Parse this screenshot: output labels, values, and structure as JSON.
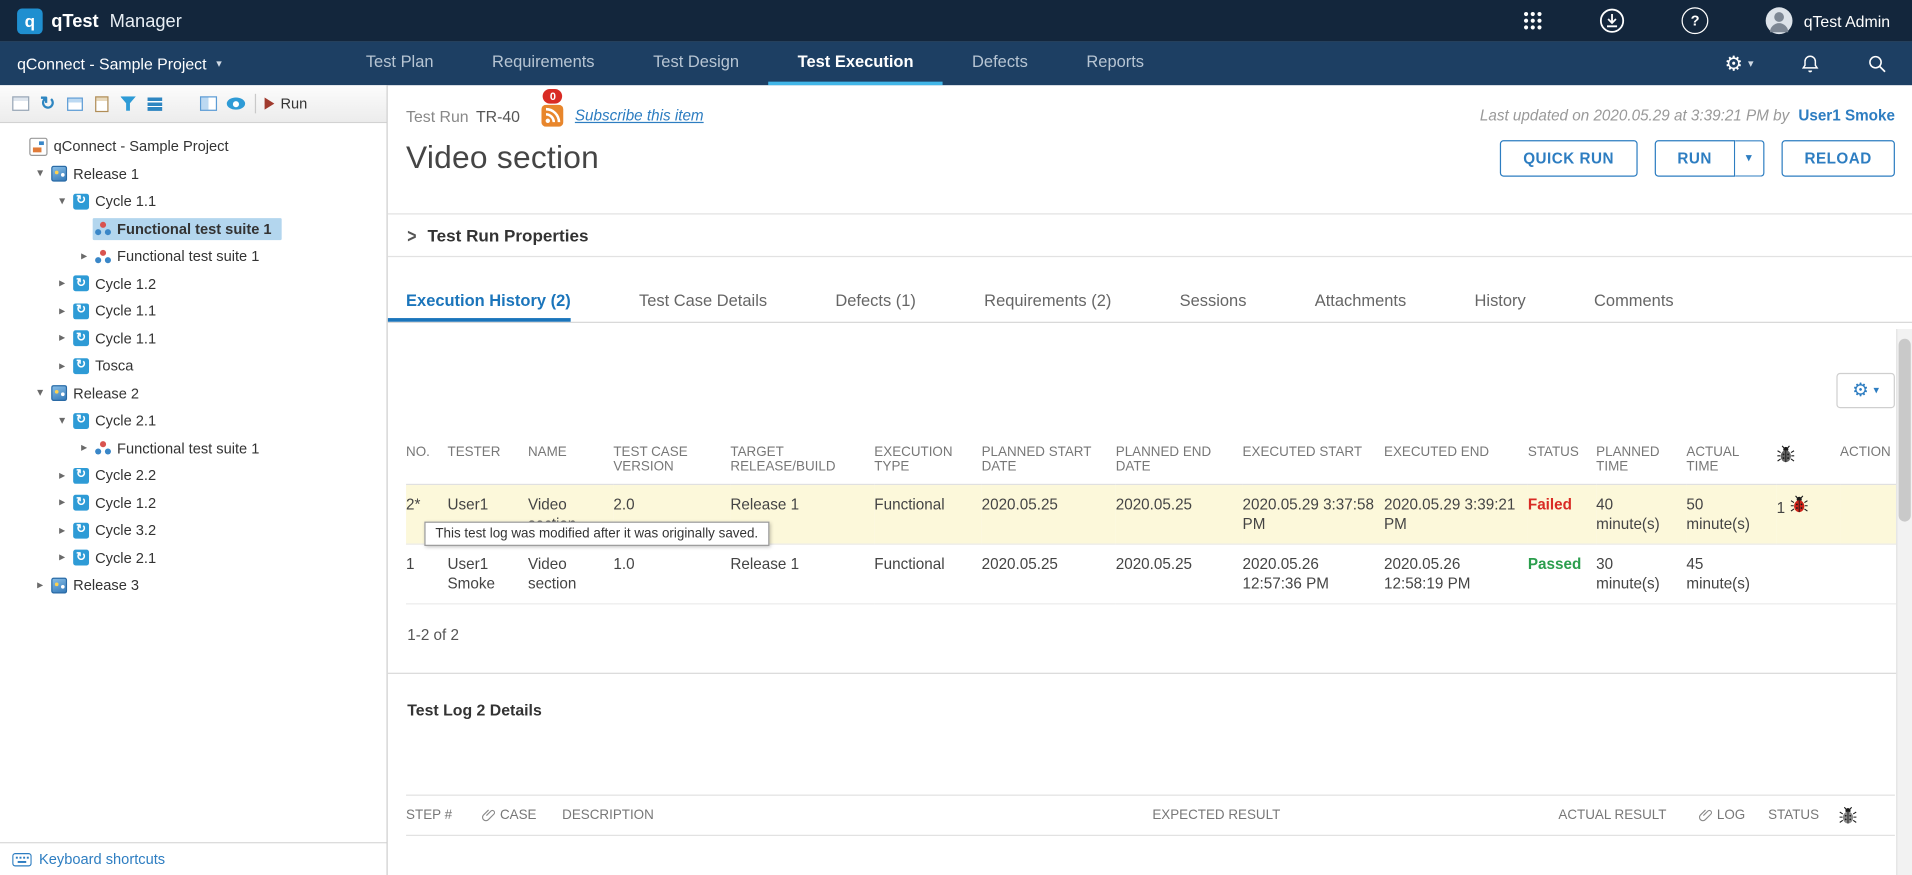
{
  "colors": {
    "topbar_bg": "#13263c",
    "navbar_bg": "#1d3f63",
    "accent_blue": "#2d7dc1",
    "nav_active_underline": "#41b6e8",
    "active_tab_blue": "#1b75bb",
    "failed_red": "#d92b24",
    "passed_green": "#2b9e4d",
    "modified_row_bg": "#fcf8da",
    "selected_tree_bg": "#b3d6ee"
  },
  "topbar": {
    "logo_mark": "q",
    "logo_text": "qTest",
    "product": "Manager",
    "user_name": "qTest Admin"
  },
  "nav": {
    "project_selector": "qConnect - Sample Project",
    "items": [
      {
        "label": "Test Plan",
        "active": false
      },
      {
        "label": "Requirements",
        "active": false
      },
      {
        "label": "Test Design",
        "active": false
      },
      {
        "label": "Test Execution",
        "active": true
      },
      {
        "label": "Defects",
        "active": false
      },
      {
        "label": "Reports",
        "active": false
      }
    ]
  },
  "sidebar": {
    "toolbar": {
      "icons": [
        "panels",
        "refresh",
        "new-window",
        "paste",
        "filter",
        "list",
        "excel-export",
        "split",
        "eye"
      ],
      "run_label": "Run"
    },
    "tree": [
      {
        "label": "qConnect - Sample Project",
        "level": 0,
        "type": "project",
        "state": "none",
        "selected": false
      },
      {
        "label": "Release 1",
        "level": 1,
        "type": "release",
        "state": "expanded",
        "selected": false
      },
      {
        "label": "Cycle 1.1",
        "level": 2,
        "type": "cycle",
        "state": "expanded",
        "selected": false
      },
      {
        "label": "Functional test suite 1",
        "level": 3,
        "type": "suite",
        "state": "none",
        "selected": true
      },
      {
        "label": "Functional test suite 1",
        "level": 3,
        "type": "suite",
        "state": "collapsed",
        "selected": false
      },
      {
        "label": "Cycle 1.2",
        "level": 2,
        "type": "cycle",
        "state": "collapsed",
        "selected": false
      },
      {
        "label": "Cycle 1.1",
        "level": 2,
        "type": "cycle",
        "state": "collapsed",
        "selected": false
      },
      {
        "label": "Cycle 1.1",
        "level": 2,
        "type": "cycle",
        "state": "collapsed",
        "selected": false
      },
      {
        "label": "Tosca",
        "level": 2,
        "type": "cycle",
        "state": "collapsed",
        "selected": false
      },
      {
        "label": "Release 2",
        "level": 1,
        "type": "release",
        "state": "expanded",
        "selected": false
      },
      {
        "label": "Cycle 2.1",
        "level": 2,
        "type": "cycle",
        "state": "expanded",
        "selected": false
      },
      {
        "label": "Functional test suite 1",
        "level": 3,
        "type": "suite",
        "state": "collapsed",
        "selected": false
      },
      {
        "label": "Cycle 2.2",
        "level": 2,
        "type": "cycle",
        "state": "collapsed",
        "selected": false
      },
      {
        "label": "Cycle 1.2",
        "level": 2,
        "type": "cycle",
        "state": "collapsed",
        "selected": false
      },
      {
        "label": "Cycle 3.2",
        "level": 2,
        "type": "cycle",
        "state": "collapsed",
        "selected": false
      },
      {
        "label": "Cycle 2.1",
        "level": 2,
        "type": "cycle",
        "state": "collapsed",
        "selected": false
      },
      {
        "label": "Release 3",
        "level": 1,
        "type": "release",
        "state": "collapsed",
        "selected": false
      }
    ],
    "footer_link": "Keyboard shortcuts"
  },
  "main": {
    "item_type": "Test Run",
    "item_id": "TR-40",
    "subscribe_badge": "0",
    "subscribe_label": "Subscribe this item",
    "last_updated_prefix": "Last updated on 2020.05.29 at 3:39:21 PM by",
    "last_updated_user": "User1 Smoke",
    "title": "Video section",
    "actions": {
      "quick_run": "QUICK RUN",
      "run": "RUN",
      "reload": "RELOAD"
    },
    "properties_header": "Test Run Properties",
    "tabs": [
      {
        "label": "Execution History (2)",
        "active": true
      },
      {
        "label": "Test Case Details",
        "active": false
      },
      {
        "label": "Defects (1)",
        "active": false
      },
      {
        "label": "Requirements (2)",
        "active": false
      },
      {
        "label": "Sessions",
        "active": false
      },
      {
        "label": "Attachments",
        "active": false
      },
      {
        "label": "History",
        "active": false
      },
      {
        "label": "Comments",
        "active": false
      }
    ],
    "history_table": {
      "headers": [
        {
          "label": "NO."
        },
        {
          "label": "TESTER"
        },
        {
          "label": "NAME"
        },
        {
          "label": "TEST CASE VERSION"
        },
        {
          "label": "TARGET RELEASE/BUILD"
        },
        {
          "label": "EXECUTION TYPE"
        },
        {
          "label": "PLANNED START DATE"
        },
        {
          "label": "PLANNED END DATE"
        },
        {
          "label": "EXECUTED START"
        },
        {
          "label": "EXECUTED END"
        },
        {
          "label": "STATUS"
        },
        {
          "label": "PLANNED TIME"
        },
        {
          "label": "ACTUAL TIME"
        },
        {
          "label": "",
          "icon": "bug"
        },
        {
          "label": "ACTION"
        }
      ],
      "rows": [
        {
          "no": "2*",
          "tester": "User1",
          "name": "Video section",
          "test_case_version": "2.0",
          "target_release_build": "Release 1",
          "execution_type": "Functional",
          "planned_start_date": "2020.05.25",
          "planned_end_date": "2020.05.25",
          "executed_start": "2020.05.29 3:37:58 PM",
          "executed_end": "2020.05.29 3:39:21 PM",
          "status": "Failed",
          "planned_time": "40 minute(s)",
          "actual_time": "50 minute(s)",
          "defect_count": "1",
          "action": "",
          "modified": true,
          "tooltip": "This test log was modified after it was originally saved."
        },
        {
          "no": "1",
          "tester": "User1 Smoke",
          "name": "Video section",
          "test_case_version": "1.0",
          "target_release_build": "Release 1",
          "execution_type": "Functional",
          "planned_start_date": "2020.05.25",
          "planned_end_date": "2020.05.25",
          "executed_start": "2020.05.26 12:57:36 PM",
          "executed_end": "2020.05.26 12:58:19 PM",
          "status": "Passed",
          "planned_time": "30 minute(s)",
          "actual_time": "45 minute(s)",
          "defect_count": "",
          "action": "",
          "modified": false
        }
      ],
      "pagination": "1-2 of 2"
    },
    "details": {
      "title": "Test Log 2 Details",
      "headers": [
        {
          "label": "STEP #"
        },
        {
          "label": "CASE",
          "icon": "attachment"
        },
        {
          "label": "DESCRIPTION"
        },
        {
          "label": "EXPECTED RESULT"
        },
        {
          "label": "ACTUAL RESULT"
        },
        {
          "label": "LOG",
          "icon": "attachment"
        },
        {
          "label": "STATUS"
        },
        {
          "label": "",
          "icon": "bug"
        }
      ]
    }
  }
}
